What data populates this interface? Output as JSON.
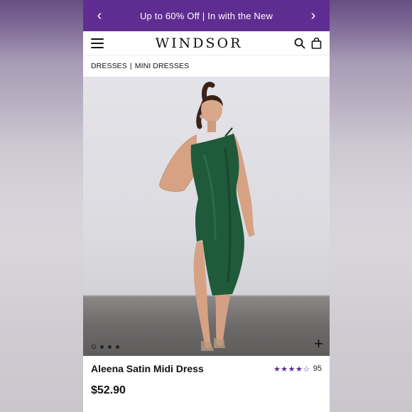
{
  "promo": {
    "prev_label": "‹",
    "text": "Up to 60% Off | In with the New",
    "next_label": "›"
  },
  "header": {
    "logo": "WINDSOR"
  },
  "breadcrumb": {
    "item1": "DRESSES",
    "separator": "|",
    "item2": "MINI DRESSES"
  },
  "gallery": {
    "dots": [
      1,
      2,
      3,
      4
    ],
    "active_index": 0,
    "zoom_label": "+"
  },
  "product": {
    "name": "Aleena Satin Midi Dress",
    "rating": 4.5,
    "review_count": "95",
    "stars": "★★★★☆",
    "price": "$52.90"
  },
  "colors": {
    "promo_bg": "#5f2d91",
    "dress": "#1f5a3a",
    "accent": "#5f2d91"
  },
  "icons": [
    "chevron-left-icon",
    "chevron-right-icon",
    "menu-icon",
    "search-icon",
    "bag-icon",
    "plus-icon",
    "star-icon"
  ]
}
